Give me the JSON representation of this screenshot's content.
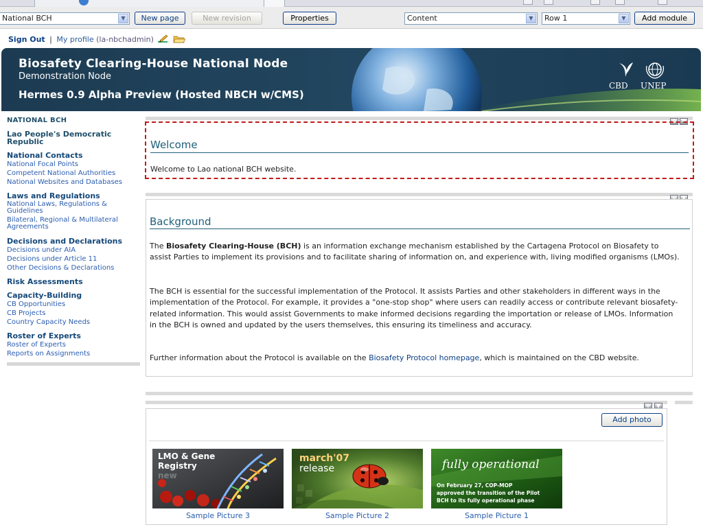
{
  "toolbar": {
    "site_select": "National BCH",
    "new_page": "New page",
    "new_revision": "New revision",
    "properties": "Properties",
    "content_select": "Content",
    "row_select": "Row 1",
    "add_module": "Add module"
  },
  "userbar": {
    "sign_out": "Sign Out",
    "separator": "|",
    "my_profile": "My profile",
    "username": "(la-nbchadmin)"
  },
  "banner": {
    "title": "Biosafety Clearing-House National Node",
    "subtitle": "Demonstration Node",
    "edition": "Hermes 0.9 Alpha Preview (Hosted NBCH w/CMS)",
    "logo_cbd": "CBD",
    "logo_unep": "UNEP"
  },
  "sidebar": {
    "heading": "NATIONAL BCH",
    "country": "Lao People's Democratic Republic",
    "groups": [
      {
        "title": "National Contacts",
        "items": [
          "National Focal Points",
          "Competent National Authorities",
          "National Websites and Databases"
        ]
      },
      {
        "title": "Laws and Regulations",
        "items": [
          "National Laws, Regulations & Guidelines",
          "Bilateral, Regional & Multilateral Agreements"
        ]
      },
      {
        "title": "Decisions and Declarations",
        "items": [
          "Decisions under AIA",
          "Decisions under Article 11",
          "Other Decisions & Declarations"
        ]
      },
      {
        "title": "Risk Assessments",
        "items": []
      },
      {
        "title": "Capacity-Building",
        "items": [
          "CB Opportunities",
          "CB Projects",
          "Country Capacity Needs"
        ]
      },
      {
        "title": "Roster of Experts",
        "items": [
          "Roster of Experts",
          "Reports on Assignments"
        ]
      }
    ]
  },
  "welcome": {
    "heading": "Welcome",
    "text": "Welcome to Lao national BCH website."
  },
  "background": {
    "heading": "Background",
    "p1_pre": "The ",
    "p1_bold": "Biosafety Clearing-House (BCH)",
    "p1_post": " is an information exchange mechanism established by the Cartagena Protocol on Biosafety to assist Parties to implement its provisions and to facilitate sharing of information on, and experience with, living modified organisms (LMOs).",
    "p2": "The BCH is essential for the successful implementation of the Protocol. It assists Parties and other stakeholders in different ways in the implementation of the Protocol. For example, it provides a \"one-stop shop\" where users can readily access or contribute relevant biosafety-related information. This would assist Governments to make informed decisions regarding the importation or release of LMOs. Information in the BCH is owned and updated by the users themselves, this ensuring its timeliness and accuracy.",
    "p3_pre": "Further information about the Protocol is available on the ",
    "p3_link": "Biosafety Protocol homepage",
    "p3_post": ", which is maintained on the CBD website."
  },
  "photos": {
    "add_photo": "Add photo",
    "items": [
      {
        "caption": "Sample Picture 3",
        "line1": "LMO & Gene",
        "line2": "Registry",
        "line3": "new"
      },
      {
        "caption": "Sample Picture 2",
        "line1": "march'07",
        "line2": "release"
      },
      {
        "caption": "Sample Picture 1",
        "line1": "fully operational",
        "line2": "On February 27, COP-MOP",
        "line3": "approved the transition of the Pilot",
        "line4": "BCH to its fully operational phase"
      }
    ]
  },
  "colors": {
    "banner": "#1c3b52",
    "heading": "#1e5f78",
    "link": "#2a5db0",
    "selection": "#c01818"
  }
}
